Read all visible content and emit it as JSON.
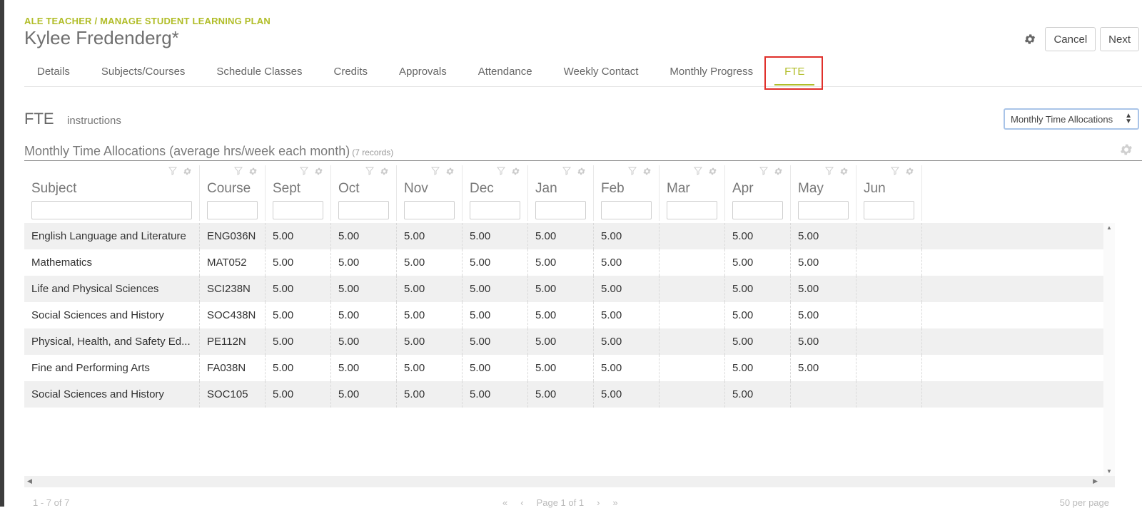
{
  "header": {
    "breadcrumb": "ALE TEACHER / MANAGE STUDENT LEARNING PLAN",
    "title": "Kylee Fredenderg*",
    "settings_icon": "gear-icon",
    "cancel_label": "Cancel",
    "next_label": "Next"
  },
  "tabs": [
    {
      "label": "Details"
    },
    {
      "label": "Subjects/Courses"
    },
    {
      "label": "Schedule Classes"
    },
    {
      "label": "Credits"
    },
    {
      "label": "Approvals"
    },
    {
      "label": "Attendance"
    },
    {
      "label": "Weekly Contact"
    },
    {
      "label": "Monthly Progress"
    },
    {
      "label": "FTE",
      "active": true
    }
  ],
  "section": {
    "title": "FTE",
    "instructions_link": "instructions",
    "view_select": "Monthly Time Allocations"
  },
  "grid": {
    "title": "Monthly Time Allocations (average hrs/week each month)",
    "record_count": "(7 records)",
    "columns": [
      "Subject",
      "Course",
      "Sept",
      "Oct",
      "Nov",
      "Dec",
      "Jan",
      "Feb",
      "Mar",
      "Apr",
      "May",
      "Jun"
    ],
    "rows": [
      [
        "English Language and Literature",
        "ENG036N",
        "5.00",
        "5.00",
        "5.00",
        "5.00",
        "5.00",
        "5.00",
        "",
        "5.00",
        "5.00",
        ""
      ],
      [
        "Mathematics",
        "MAT052",
        "5.00",
        "5.00",
        "5.00",
        "5.00",
        "5.00",
        "5.00",
        "",
        "5.00",
        "5.00",
        ""
      ],
      [
        "Life and Physical Sciences",
        "SCI238N",
        "5.00",
        "5.00",
        "5.00",
        "5.00",
        "5.00",
        "5.00",
        "",
        "5.00",
        "5.00",
        ""
      ],
      [
        "Social Sciences and History",
        "SOC438N",
        "5.00",
        "5.00",
        "5.00",
        "5.00",
        "5.00",
        "5.00",
        "",
        "5.00",
        "5.00",
        ""
      ],
      [
        "Physical, Health, and Safety Ed...",
        "PE112N",
        "5.00",
        "5.00",
        "5.00",
        "5.00",
        "5.00",
        "5.00",
        "",
        "5.00",
        "5.00",
        ""
      ],
      [
        "Fine and Performing Arts",
        "FA038N",
        "5.00",
        "5.00",
        "5.00",
        "5.00",
        "5.00",
        "5.00",
        "",
        "5.00",
        "5.00",
        ""
      ],
      [
        "Social Sciences and History",
        "SOC105",
        "5.00",
        "5.00",
        "5.00",
        "5.00",
        "5.00",
        "5.00",
        "",
        "5.00",
        "",
        ""
      ]
    ]
  },
  "footer": {
    "range": "1 - 7 of 7",
    "page": "Page 1 of 1",
    "per_page": "50 per page"
  },
  "colors": {
    "accent": "#b1bd28",
    "highlight": "#e0302b"
  }
}
